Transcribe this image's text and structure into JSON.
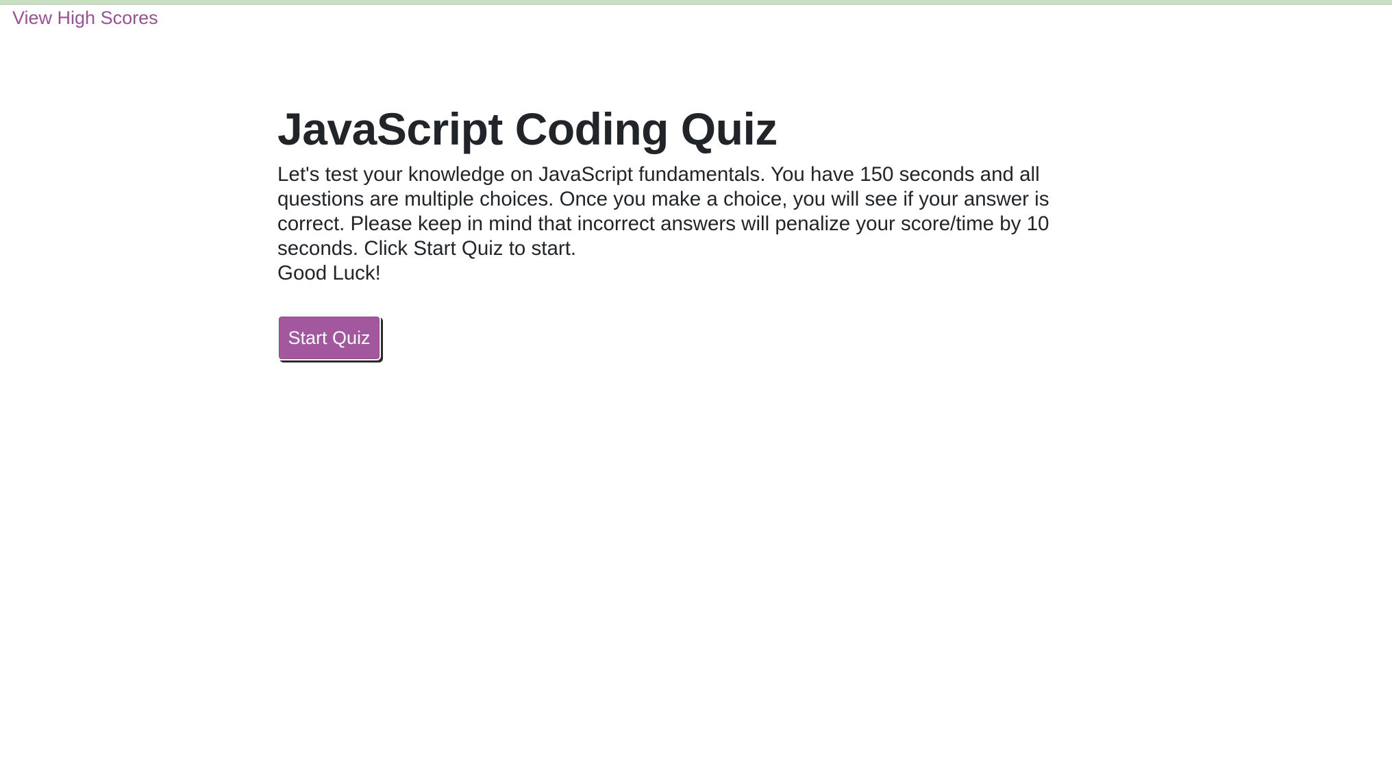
{
  "nav": {
    "high_scores_label": "View High Scores"
  },
  "intro": {
    "title": "JavaScript Coding Quiz",
    "description": "Let's test your knowledge on JavaScript fundamentals. You have 150 seconds and all questions are multiple choices. Once you make a choice, you will see if your answer is correct. Please keep in mind that incorrect answers will penalize your score/time by 10 seconds. Click Start Quiz to start.",
    "closing": "Good Luck!"
  },
  "actions": {
    "start_label": "Start Quiz"
  },
  "colors": {
    "accent": "#a2579f",
    "link": "#9a4f98",
    "top_strip": "#c9dfc1",
    "text": "#212529"
  }
}
